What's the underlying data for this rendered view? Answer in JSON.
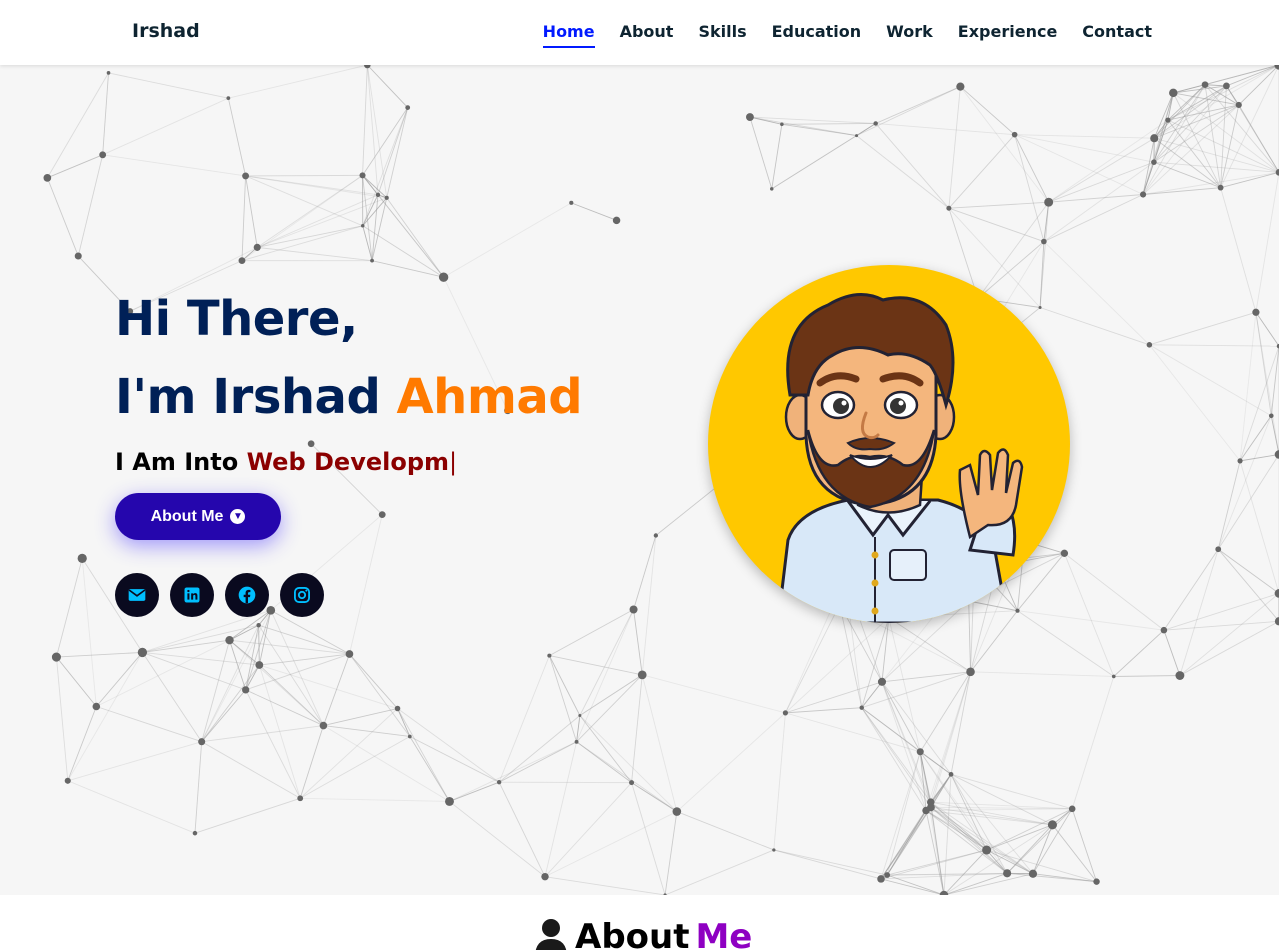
{
  "header": {
    "logo": "Irshad",
    "nav": [
      {
        "label": "Home",
        "active": true
      },
      {
        "label": "About"
      },
      {
        "label": "Skills"
      },
      {
        "label": "Education"
      },
      {
        "label": "Work"
      },
      {
        "label": "Experience"
      },
      {
        "label": "Contact"
      }
    ]
  },
  "hero": {
    "greeting": "Hi There,",
    "intro_prefix": "I'm Irshad ",
    "intro_accent": "Ahmad",
    "typing_prefix": "I Am Into ",
    "typing_value": "Web Developm",
    "typing_cursor": "|",
    "button_label": "About Me",
    "button_icon": "arrow-down-circle-icon",
    "socials": [
      {
        "icon": "envelope-icon"
      },
      {
        "icon": "linkedin-icon"
      },
      {
        "icon": "facebook-icon"
      },
      {
        "icon": "instagram-icon"
      }
    ],
    "avatar_icon": "cartoon-avatar"
  },
  "about": {
    "icon": "user-icon",
    "title_prefix": "About ",
    "title_accent": "Me"
  },
  "colors": {
    "nav_active": "#011aff",
    "heading": "#002057",
    "accent_orange": "#ff7a00",
    "typing_accent": "#8b0000",
    "button": "#2506ad",
    "social_icon": "#00bfff",
    "avatar_bg": "#ffc800",
    "about_accent": "#8e00c2"
  }
}
